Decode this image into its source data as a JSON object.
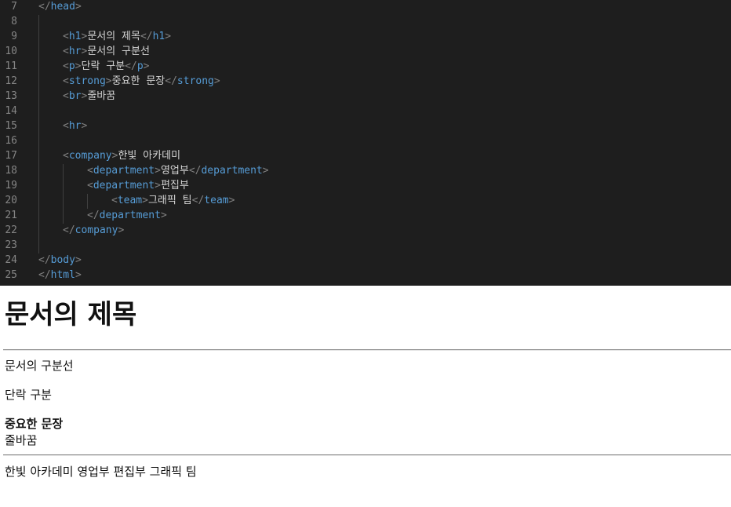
{
  "editor": {
    "lines": [
      {
        "num": "7",
        "indent": 0,
        "parts": [
          [
            "b",
            "</"
          ],
          [
            "t",
            "head"
          ],
          [
            "b",
            ">"
          ]
        ]
      },
      {
        "num": "8",
        "indent": 0,
        "parts": []
      },
      {
        "num": "9",
        "indent": 1,
        "parts": [
          [
            "b",
            "<"
          ],
          [
            "t",
            "h1"
          ],
          [
            "b",
            ">"
          ],
          [
            "x",
            "문서의 제목"
          ],
          [
            "b",
            "</"
          ],
          [
            "t",
            "h1"
          ],
          [
            "b",
            ">"
          ]
        ]
      },
      {
        "num": "10",
        "indent": 1,
        "parts": [
          [
            "b",
            "<"
          ],
          [
            "t",
            "hr"
          ],
          [
            "b",
            ">"
          ],
          [
            "x",
            "문서의 구분선"
          ]
        ]
      },
      {
        "num": "11",
        "indent": 1,
        "parts": [
          [
            "b",
            "<"
          ],
          [
            "t",
            "p"
          ],
          [
            "b",
            ">"
          ],
          [
            "x",
            "단락 구분"
          ],
          [
            "b",
            "</"
          ],
          [
            "t",
            "p"
          ],
          [
            "b",
            ">"
          ]
        ]
      },
      {
        "num": "12",
        "indent": 1,
        "parts": [
          [
            "b",
            "<"
          ],
          [
            "t",
            "strong"
          ],
          [
            "b",
            ">"
          ],
          [
            "x",
            "중요한 문장"
          ],
          [
            "b",
            "</"
          ],
          [
            "t",
            "strong"
          ],
          [
            "b",
            ">"
          ]
        ]
      },
      {
        "num": "13",
        "indent": 1,
        "parts": [
          [
            "b",
            "<"
          ],
          [
            "t",
            "br"
          ],
          [
            "b",
            ">"
          ],
          [
            "x",
            "줄바꿈"
          ]
        ]
      },
      {
        "num": "14",
        "indent": 0,
        "parts": []
      },
      {
        "num": "15",
        "indent": 1,
        "parts": [
          [
            "b",
            "<"
          ],
          [
            "t",
            "hr"
          ],
          [
            "b",
            ">"
          ]
        ]
      },
      {
        "num": "16",
        "indent": 0,
        "parts": []
      },
      {
        "num": "17",
        "indent": 1,
        "parts": [
          [
            "b",
            "<"
          ],
          [
            "t",
            "company"
          ],
          [
            "b",
            ">"
          ],
          [
            "x",
            "한빛 아카데미"
          ]
        ]
      },
      {
        "num": "18",
        "indent": 2,
        "parts": [
          [
            "b",
            "<"
          ],
          [
            "t",
            "department"
          ],
          [
            "b",
            ">"
          ],
          [
            "x",
            "영업부"
          ],
          [
            "b",
            "</"
          ],
          [
            "t",
            "department"
          ],
          [
            "b",
            ">"
          ]
        ]
      },
      {
        "num": "19",
        "indent": 2,
        "parts": [
          [
            "b",
            "<"
          ],
          [
            "t",
            "department"
          ],
          [
            "b",
            ">"
          ],
          [
            "x",
            "편집부"
          ]
        ]
      },
      {
        "num": "20",
        "indent": 3,
        "parts": [
          [
            "b",
            "<"
          ],
          [
            "t",
            "team"
          ],
          [
            "b",
            ">"
          ],
          [
            "x",
            "그래픽 팀"
          ],
          [
            "b",
            "</"
          ],
          [
            "t",
            "team"
          ],
          [
            "b",
            ">"
          ]
        ]
      },
      {
        "num": "21",
        "indent": 2,
        "parts": [
          [
            "b",
            "</"
          ],
          [
            "t",
            "department"
          ],
          [
            "b",
            ">"
          ]
        ]
      },
      {
        "num": "22",
        "indent": 1,
        "parts": [
          [
            "b",
            "</"
          ],
          [
            "t",
            "company"
          ],
          [
            "b",
            ">"
          ]
        ]
      },
      {
        "num": "23",
        "indent": 0,
        "parts": []
      },
      {
        "num": "24",
        "indent": 0,
        "parts": [
          [
            "b",
            "</"
          ],
          [
            "t",
            "body"
          ],
          [
            "b",
            ">"
          ]
        ]
      },
      {
        "num": "25",
        "indent": 0,
        "parts": [
          [
            "b",
            "</"
          ],
          [
            "t",
            "html"
          ],
          [
            "b",
            ">"
          ]
        ]
      }
    ],
    "colors": {
      "background": "#1e1e1e",
      "line_number": "#858585",
      "bracket": "#808080",
      "tag_name": "#569cd6",
      "text": "#d4d4d4"
    }
  },
  "preview": {
    "heading": "문서의 제목",
    "hr_text": "문서의 구분선",
    "paragraph": "단락 구분",
    "strong_text": "중요한 문장",
    "br_text": "줄바꿈",
    "company_line": "한빛 아카데미 영업부 편집부 그래픽 팀"
  }
}
